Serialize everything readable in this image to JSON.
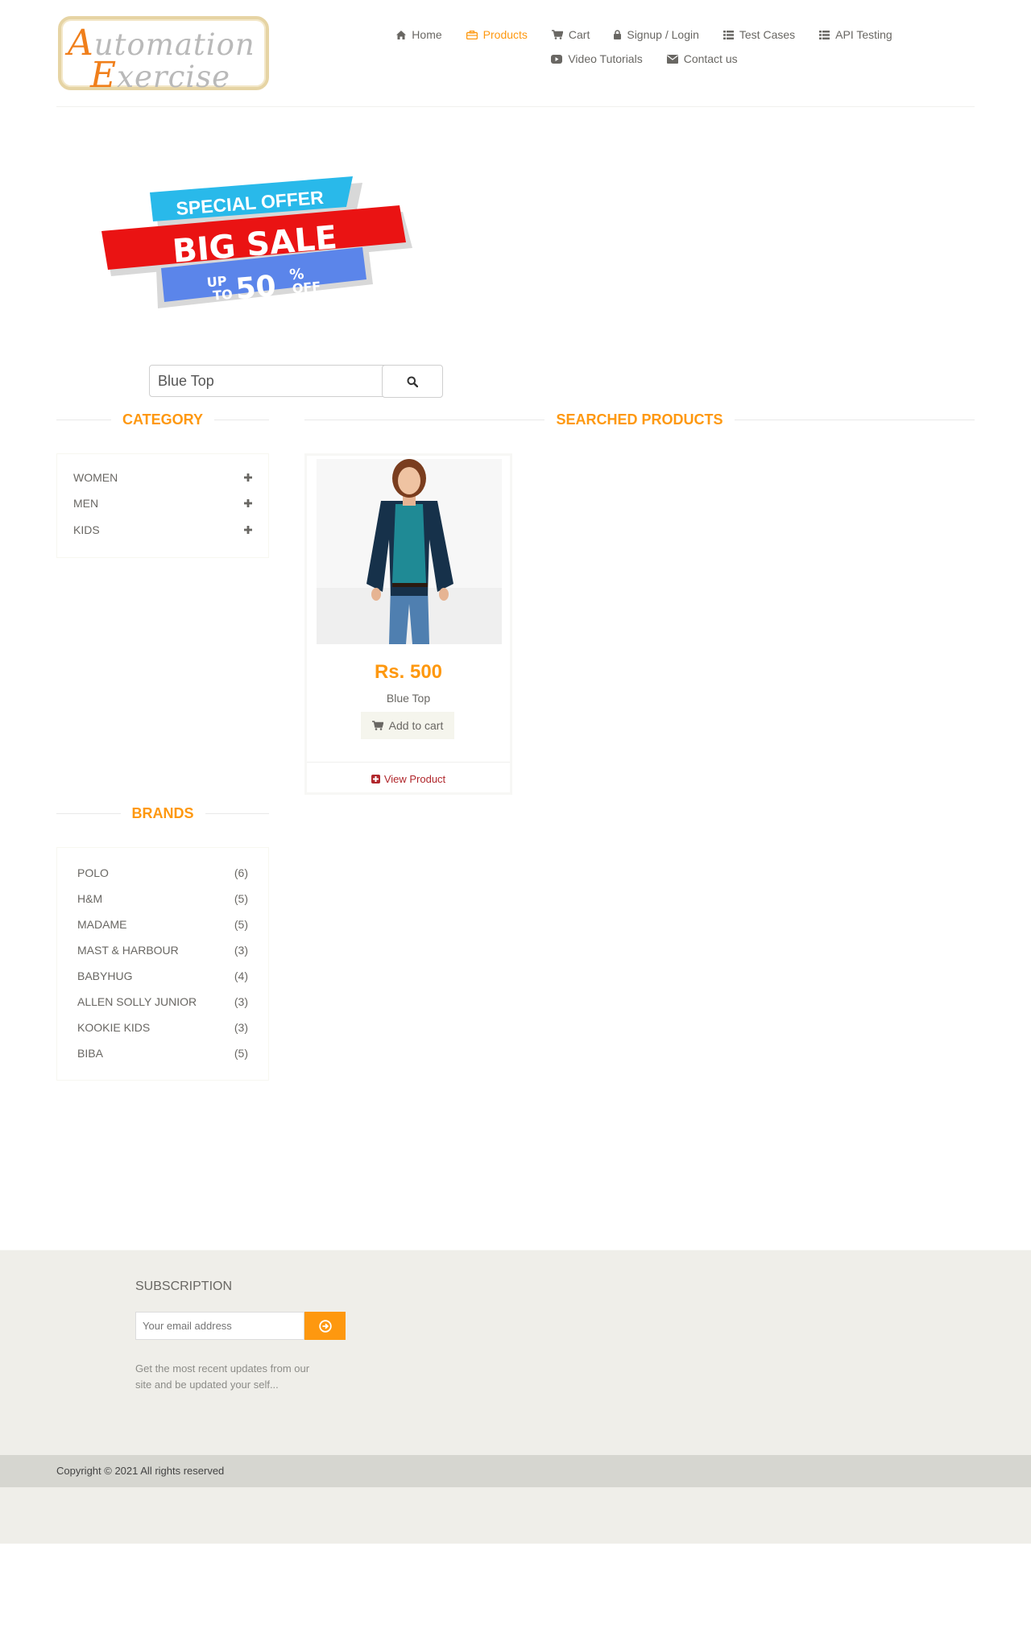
{
  "brand": {
    "logo_line1": "Automation",
    "logo_line2": "Exercise"
  },
  "nav": {
    "items": [
      {
        "label": "Home",
        "icon": "home-icon"
      },
      {
        "label": "Products",
        "icon": "briefcase-icon",
        "active": true
      },
      {
        "label": "Cart",
        "icon": "cart-icon"
      },
      {
        "label": "Signup / Login",
        "icon": "lock-icon"
      },
      {
        "label": "Test Cases",
        "icon": "list-icon"
      },
      {
        "label": "API Testing",
        "icon": "list-icon"
      },
      {
        "label": "Video Tutorials",
        "icon": "youtube-play-icon"
      },
      {
        "label": "Contact us",
        "icon": "envelope-icon"
      }
    ]
  },
  "banner": {
    "line1": "SPECIAL OFFER",
    "line2": "BIG SALE",
    "up": "UP",
    "to": "TO",
    "value": "50",
    "pct": "%",
    "off": "OFF"
  },
  "search": {
    "value": "Blue Top",
    "button_icon": "search-icon"
  },
  "sidebar": {
    "category_title": "Category",
    "categories": [
      {
        "label": "Women"
      },
      {
        "label": "Men"
      },
      {
        "label": "Kids"
      }
    ],
    "brands_title": "Brands",
    "brands": [
      {
        "name": "Polo",
        "count": "(6)"
      },
      {
        "name": "H&M",
        "count": "(5)"
      },
      {
        "name": "Madame",
        "count": "(5)"
      },
      {
        "name": "Mast & Harbour",
        "count": "(3)"
      },
      {
        "name": "Babyhug",
        "count": "(4)"
      },
      {
        "name": "Allen Solly Junior",
        "count": "(3)"
      },
      {
        "name": "Kookie Kids",
        "count": "(3)"
      },
      {
        "name": "Biba",
        "count": "(5)"
      }
    ]
  },
  "results": {
    "title": "Searched Products",
    "products": [
      {
        "price": "Rs. 500",
        "name": "Blue Top",
        "add_label": "Add to cart",
        "view_label": "View Product"
      }
    ]
  },
  "footer": {
    "subscription_title": "Subscription",
    "email_placeholder": "Your email address",
    "subscribe_icon": "arrow-circle-right-icon",
    "subscription_text": "Get the most recent updates from our site and be updated your self...",
    "copyright": "Copyright © 2021 All rights reserved"
  },
  "colors": {
    "accent": "#FE980F",
    "text": "#696763",
    "footer_bg": "#EFEEE9",
    "footer_bar": "#D6D6D0"
  }
}
